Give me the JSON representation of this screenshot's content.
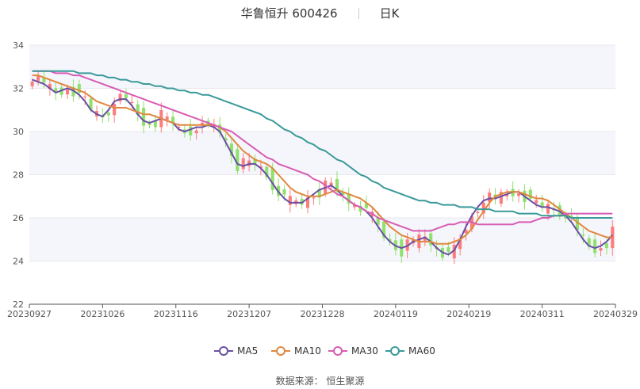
{
  "header": {
    "title": "华鲁恒升 600426",
    "period": "日K"
  },
  "source": "数据来源： 恒生聚源",
  "chart_data": {
    "type": "candlestick",
    "ylim": [
      22,
      34
    ],
    "y_ticks": [
      22,
      24,
      26,
      28,
      30,
      32,
      34
    ],
    "x_ticks": [
      "20230927",
      "20231026",
      "20231116",
      "20231207",
      "20231228",
      "20240119",
      "20240219",
      "20240311",
      "20240329"
    ],
    "legend_position": "bottom",
    "grid": true,
    "colors": {
      "up": "#fb7c7c",
      "down": "#8fe06d"
    },
    "series": [
      {
        "name": "MA5",
        "color": "#6a4fa3",
        "values": [
          32.4,
          32.3,
          32.2,
          32.0,
          31.8,
          31.9,
          32.0,
          31.9,
          31.7,
          31.4,
          31.0,
          30.8,
          30.7,
          31.0,
          31.4,
          31.5,
          31.5,
          31.2,
          30.8,
          30.5,
          30.4,
          30.5,
          30.6,
          30.5,
          30.4,
          30.1,
          30.0,
          30.1,
          30.2,
          30.2,
          30.3,
          30.2,
          30.0,
          29.5,
          29.0,
          28.5,
          28.4,
          28.5,
          28.5,
          28.3,
          28.0,
          27.6,
          27.2,
          26.9,
          26.7,
          26.7,
          26.7,
          26.9,
          27.1,
          27.3,
          27.4,
          27.5,
          27.3,
          27.0,
          26.8,
          26.6,
          26.5,
          26.3,
          26.0,
          25.6,
          25.2,
          24.9,
          24.7,
          24.6,
          24.7,
          24.9,
          25.0,
          25.1,
          24.9,
          24.6,
          24.4,
          24.3,
          24.5,
          25.0,
          25.6,
          26.1,
          26.5,
          26.8,
          26.9,
          26.9,
          27.0,
          27.1,
          27.2,
          27.2,
          27.0,
          26.8,
          26.6,
          26.5,
          26.5,
          26.4,
          26.3,
          26.1,
          25.8,
          25.4,
          25.0,
          24.7,
          24.6,
          24.7,
          24.9,
          25.2
        ]
      },
      {
        "name": "MA10",
        "color": "#e0883f",
        "values": [
          32.6,
          32.6,
          32.5,
          32.4,
          32.3,
          32.2,
          32.1,
          32.0,
          31.9,
          31.8,
          31.6,
          31.4,
          31.3,
          31.2,
          31.1,
          31.1,
          31.1,
          31.0,
          30.9,
          30.8,
          30.8,
          30.7,
          30.6,
          30.5,
          30.4,
          30.3,
          30.3,
          30.3,
          30.3,
          30.3,
          30.3,
          30.3,
          30.2,
          30.0,
          29.7,
          29.4,
          29.1,
          28.9,
          28.7,
          28.6,
          28.5,
          28.3,
          28.0,
          27.7,
          27.4,
          27.2,
          27.1,
          27.0,
          27.0,
          27.0,
          27.1,
          27.2,
          27.3,
          27.2,
          27.1,
          27.0,
          26.9,
          26.7,
          26.5,
          26.2,
          25.9,
          25.6,
          25.4,
          25.2,
          25.1,
          25.0,
          24.9,
          24.9,
          24.9,
          24.8,
          24.8,
          24.8,
          24.9,
          25.0,
          25.2,
          25.5,
          25.9,
          26.3,
          26.7,
          27.0,
          27.1,
          27.2,
          27.2,
          27.2,
          27.1,
          27.0,
          26.9,
          26.9,
          26.8,
          26.6,
          26.4,
          26.2,
          26.0,
          25.8,
          25.6,
          25.4,
          25.3,
          25.2,
          25.1,
          25.1
        ]
      },
      {
        "name": "MA30",
        "color": "#d85cb4",
        "values": [
          32.8,
          32.8,
          32.8,
          32.8,
          32.7,
          32.7,
          32.7,
          32.6,
          32.6,
          32.5,
          32.4,
          32.3,
          32.2,
          32.1,
          32.0,
          31.9,
          31.8,
          31.7,
          31.6,
          31.5,
          31.4,
          31.3,
          31.2,
          31.1,
          31.0,
          30.9,
          30.8,
          30.7,
          30.6,
          30.5,
          30.4,
          30.3,
          30.2,
          30.1,
          30.0,
          29.8,
          29.6,
          29.4,
          29.2,
          29.0,
          28.8,
          28.7,
          28.5,
          28.4,
          28.3,
          28.2,
          28.1,
          28.0,
          27.8,
          27.7,
          27.5,
          27.3,
          27.1,
          27.0,
          26.8,
          26.6,
          26.5,
          26.3,
          26.2,
          26.0,
          25.9,
          25.8,
          25.7,
          25.6,
          25.5,
          25.4,
          25.4,
          25.4,
          25.4,
          25.5,
          25.6,
          25.7,
          25.7,
          25.8,
          25.8,
          25.8,
          25.7,
          25.7,
          25.7,
          25.7,
          25.7,
          25.7,
          25.7,
          25.8,
          25.8,
          25.8,
          25.9,
          26.0,
          26.0,
          26.1,
          26.1,
          26.2,
          26.2,
          26.2,
          26.2,
          26.2,
          26.2,
          26.2,
          26.2,
          26.2
        ]
      },
      {
        "name": "MA60",
        "color": "#3a9a9a",
        "values": [
          32.8,
          32.8,
          32.8,
          32.8,
          32.8,
          32.8,
          32.8,
          32.8,
          32.7,
          32.7,
          32.7,
          32.6,
          32.6,
          32.5,
          32.5,
          32.4,
          32.4,
          32.3,
          32.3,
          32.2,
          32.2,
          32.1,
          32.1,
          32.0,
          32.0,
          31.9,
          31.9,
          31.8,
          31.8,
          31.7,
          31.7,
          31.6,
          31.5,
          31.4,
          31.3,
          31.2,
          31.1,
          31.0,
          30.9,
          30.8,
          30.6,
          30.5,
          30.3,
          30.1,
          30.0,
          29.8,
          29.7,
          29.5,
          29.4,
          29.2,
          29.1,
          28.9,
          28.7,
          28.6,
          28.4,
          28.2,
          28.0,
          27.9,
          27.7,
          27.6,
          27.4,
          27.3,
          27.2,
          27.1,
          27.0,
          26.9,
          26.8,
          26.8,
          26.7,
          26.7,
          26.6,
          26.6,
          26.6,
          26.5,
          26.5,
          26.5,
          26.4,
          26.4,
          26.4,
          26.3,
          26.3,
          26.3,
          26.3,
          26.2,
          26.2,
          26.2,
          26.2,
          26.1,
          26.1,
          26.1,
          26.1,
          26.1,
          26.0,
          26.0,
          26.0,
          26.0,
          26.0,
          26.0,
          26.0,
          26.0
        ]
      }
    ]
  }
}
